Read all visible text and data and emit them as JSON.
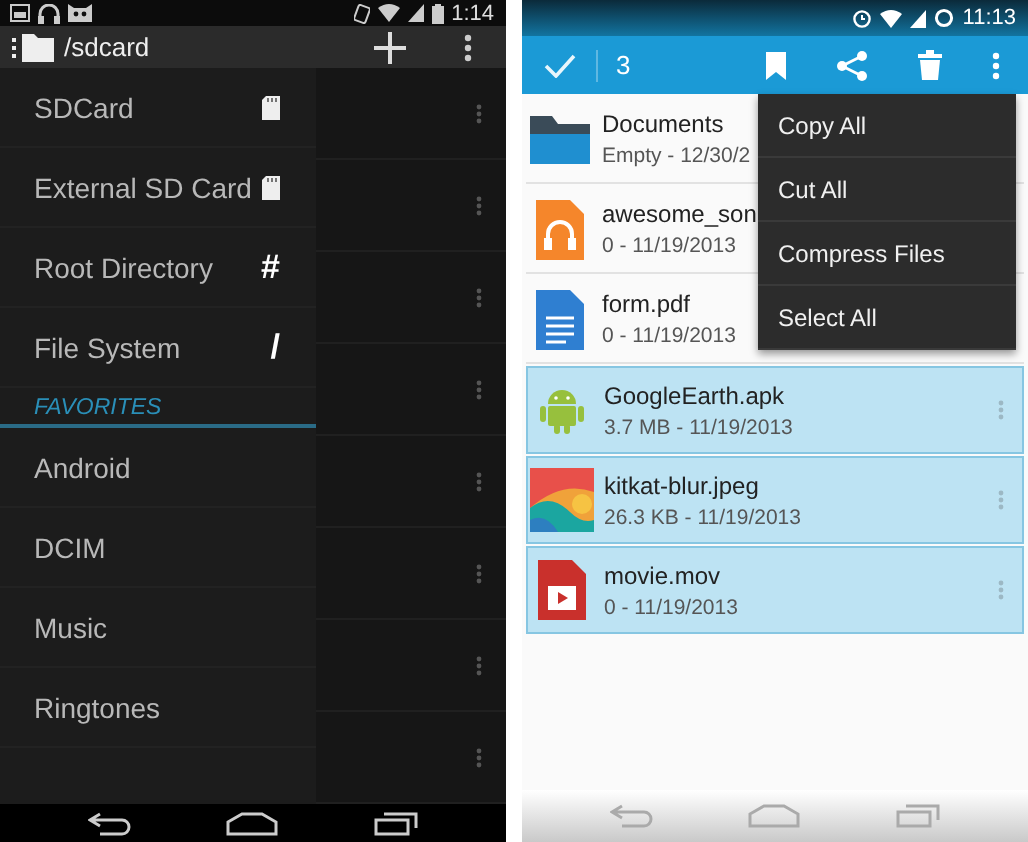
{
  "left": {
    "status_bar": {
      "time": "1:14"
    },
    "action_bar": {
      "path": "/sdcard"
    },
    "drawer": {
      "items": [
        {
          "label": "SDCard",
          "kind": "sdcard"
        },
        {
          "label": "External SD Card",
          "kind": "sdcard"
        },
        {
          "label": "Root Directory",
          "kind": "glyph",
          "glyph": "#"
        },
        {
          "label": "File System",
          "kind": "glyph",
          "glyph": "/"
        }
      ],
      "section": "FAVORITES",
      "favorites": [
        {
          "label": "Android"
        },
        {
          "label": "DCIM"
        },
        {
          "label": "Music"
        },
        {
          "label": "Ringtones"
        }
      ]
    }
  },
  "right": {
    "status_bar": {
      "time": "11:13"
    },
    "action_bar": {
      "count": "3"
    },
    "files": [
      {
        "name": "Documents",
        "detail": "Empty - 12/30/2",
        "kind": "folder",
        "selected": false
      },
      {
        "name": "awesome_son",
        "detail": "0 - 11/19/2013",
        "kind": "audio",
        "selected": false
      },
      {
        "name": "form.pdf",
        "detail": "0 - 11/19/2013",
        "kind": "text",
        "selected": false
      },
      {
        "name": "GoogleEarth.apk",
        "detail": "3.7 MB - 11/19/2013",
        "kind": "apk",
        "selected": true
      },
      {
        "name": "kitkat-blur.jpeg",
        "detail": "26.3 KB - 11/19/2013",
        "selected": true
      },
      {
        "name": "movie.mov",
        "detail": "0 - 11/19/2013",
        "kind": "video",
        "selected": true
      }
    ],
    "menu": [
      "Copy All",
      "Cut All",
      "Compress Files",
      "Select All"
    ]
  }
}
